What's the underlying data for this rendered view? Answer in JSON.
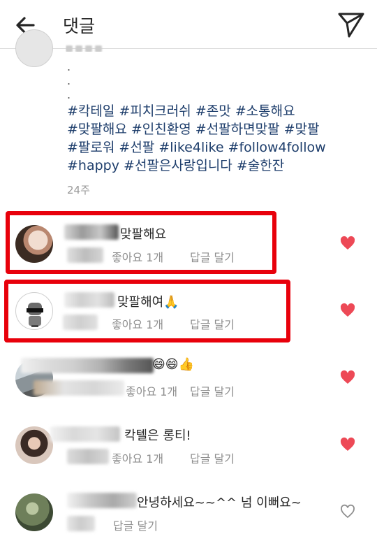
{
  "header": {
    "title": "댓글"
  },
  "caption": {
    "hashtags": [
      "#칵테일",
      "#피치크러쉬",
      "#존맛",
      "#소통해요",
      "#맞팔해요",
      "#인친환영",
      "#선팔하면맞팔",
      "#맞팔",
      "#팔로워",
      "#선팔",
      "#like4like",
      "#follow4follow",
      "#happy",
      "#선팔은사랑입니다",
      "#술한잔"
    ],
    "time": "24주"
  },
  "comments": [
    {
      "text": "맞팔해요",
      "likes": "좋아요 1개",
      "reply": "답글 달기",
      "liked": true
    },
    {
      "text": "맞팔해여🙏",
      "likes": "좋아요 1개",
      "reply": "답글 달기",
      "liked": true
    },
    {
      "text": "😄😄👍",
      "likes": "좋아요 1개",
      "reply": "답글 달기",
      "liked": true
    },
    {
      "text": "칵텔은 롱티!",
      "likes": "좋아요 1개",
      "reply": "답글 달기",
      "liked": true
    },
    {
      "text": "안녕하세요~~^^ 넘 이뻐요~",
      "likes": "",
      "reply": "답글 달기",
      "liked": false
    }
  ],
  "colors": {
    "highlight": "#e8000b",
    "heart": "#ed4956",
    "hashtag": "#1d3d6b"
  }
}
